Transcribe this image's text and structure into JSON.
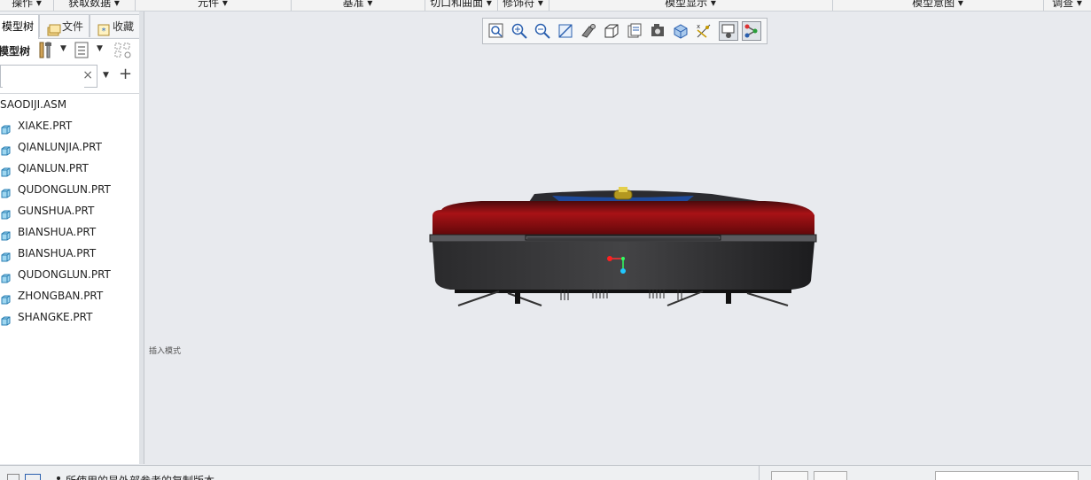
{
  "ribbon": {
    "groups": [
      "操作",
      "获取数据",
      "元件",
      "基准",
      "切口和曲面",
      "修饰符",
      "模型显示",
      "模型意图",
      "调查"
    ]
  },
  "left_panel": {
    "tabs": [
      {
        "label": "模型树",
        "icon": "model-tree-icon"
      },
      {
        "label": "文件",
        "icon": "folder-icon"
      },
      {
        "label": "收藏",
        "icon": "favorites-icon"
      }
    ],
    "toolbar_label": "模型树",
    "search": {
      "value": "",
      "placeholder": ""
    },
    "clear_symbol": "×",
    "add_symbol": "+",
    "tree": {
      "root": "SAODIJI.ASM",
      "items": [
        "XIAKE.PRT",
        "QIANLUNJIA.PRT",
        "QIANLUN.PRT",
        "QUDONGLUN.PRT",
        "GUNSHUA.PRT",
        "BIANSHUA.PRT",
        "BIANSHUA.PRT",
        "QUDONGLUN.PRT",
        "ZHONGBAN.PRT",
        "SHANGKE.PRT"
      ]
    }
  },
  "viewport": {
    "insert_label": "插入模式",
    "toolbar_icons": [
      "refit-icon",
      "zoom-in-icon",
      "zoom-out-icon",
      "repaint-icon",
      "display-style-icon",
      "saved-orientations-icon",
      "view-manager-icon",
      "perspective-view-icon",
      "section-icon",
      "datum-display-icon",
      "spin-center-icon",
      "annotation-display-icon"
    ]
  },
  "statusbar": {
    "message": "所使用的是外部参考的复制版本"
  },
  "colors": {
    "viewport_bg": "#e8eaee",
    "model_red": "#8c0d10",
    "model_dark": "#2e2e30",
    "highlight_blue": "#1e5aa8"
  }
}
